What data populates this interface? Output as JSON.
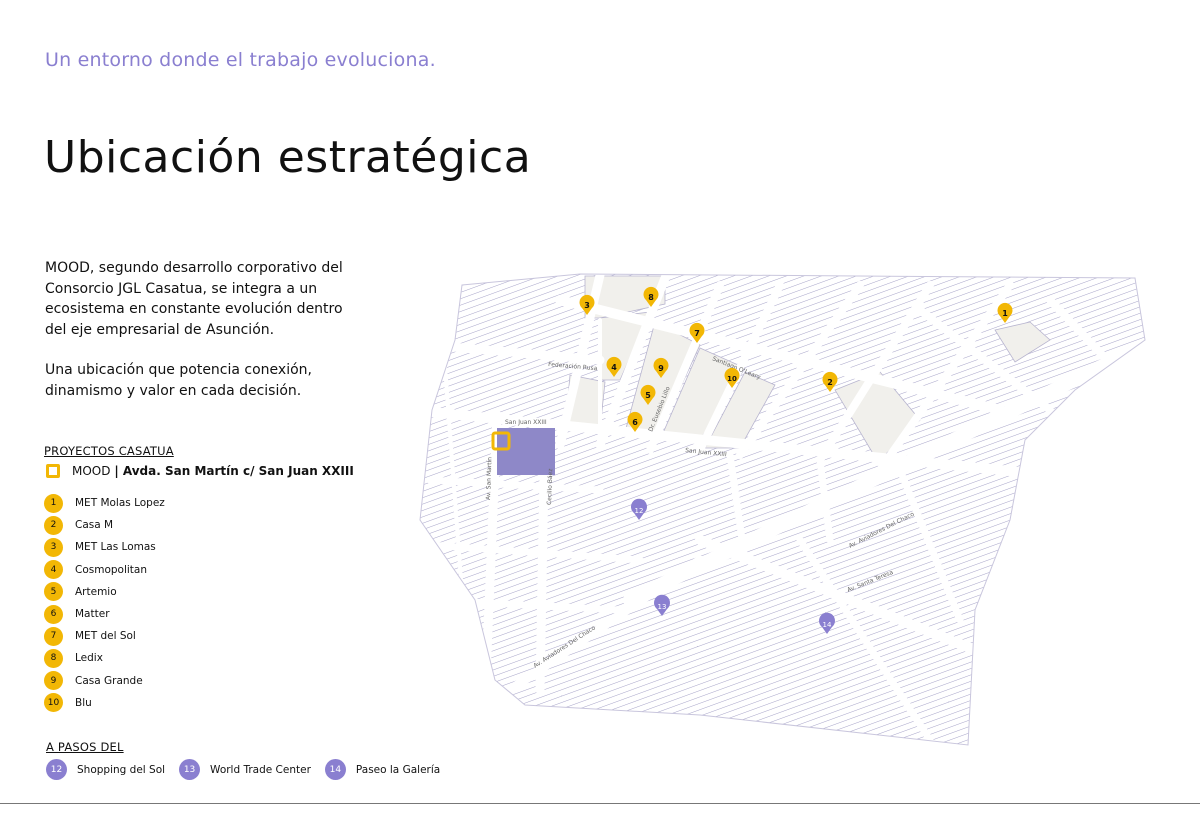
{
  "header": {
    "kicker": "Un entorno donde el trabajo evoluciona.",
    "title": "Ubicación estratégica"
  },
  "intro": {
    "p1": "MOOD, segundo desarrollo corporativo del Consorcio JGL Casatua, se integra a un ecosistema en constante evolución dentro del eje empresarial de Asunción.",
    "p2": "Una ubicación que potencia conexión, dinamismo y valor en cada decisión."
  },
  "projects": {
    "heading": "PROYECTOS CASATUA",
    "mood": {
      "name": "MOOD",
      "address": "| Avda. San Martín c/ San Juan XXIII"
    },
    "items": [
      {
        "num": "1",
        "name": "MET Molas Lopez"
      },
      {
        "num": "2",
        "name": "Casa M"
      },
      {
        "num": "3",
        "name": "MET Las Lomas"
      },
      {
        "num": "4",
        "name": "Cosmopolitan"
      },
      {
        "num": "5",
        "name": "Artemio"
      },
      {
        "num": "6",
        "name": "Matter"
      },
      {
        "num": "7",
        "name": "MET del Sol"
      },
      {
        "num": "8",
        "name": "Ledix"
      },
      {
        "num": "9",
        "name": "Casa Grande"
      },
      {
        "num": "10",
        "name": "Blu"
      }
    ]
  },
  "nearby": {
    "heading": "A PASOS DEL",
    "items": [
      {
        "num": "12",
        "name": "Shopping del Sol"
      },
      {
        "num": "13",
        "name": "World Trade Center"
      },
      {
        "num": "14",
        "name": "Paseo la Galería"
      }
    ]
  },
  "map": {
    "streets": {
      "s1": "San Juan XXIII",
      "s2": "Federación Rusa",
      "s3": "Av. Aviadores Del Chaco",
      "s4": "Av. Santa Teresa",
      "s5": "Av. San Martín",
      "s6": "Cecilio Báez",
      "s7": "Santiago O'Leary",
      "s8": "Dr. Eusebio Lillo"
    },
    "pins": [
      "1",
      "2",
      "3",
      "4",
      "5",
      "6",
      "7",
      "8",
      "9",
      "10"
    ],
    "places": [
      "12",
      "13",
      "14"
    ]
  },
  "colors": {
    "accent": "#f2b705",
    "brand": "#8a7fd0",
    "mood_lot": "#8e88c8"
  }
}
